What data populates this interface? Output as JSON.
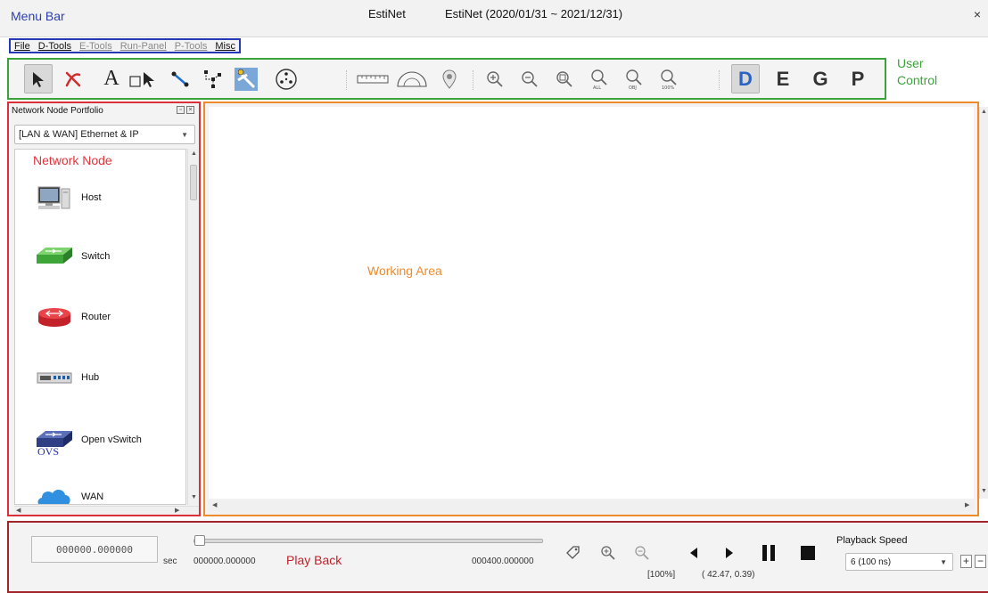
{
  "window": {
    "annotation_menubar": "Menu Bar",
    "app_name": "EstiNet",
    "title": "EstiNet  (2020/01/31 ~ 2021/12/31)",
    "close": "×"
  },
  "menubar": {
    "items": [
      {
        "label": "File",
        "enabled": true
      },
      {
        "label": "D-Tools",
        "enabled": true
      },
      {
        "label": "E-Tools",
        "enabled": false
      },
      {
        "label": "Run-Panel",
        "enabled": false
      },
      {
        "label": "P-Tools",
        "enabled": false
      },
      {
        "label": "Misc",
        "enabled": true
      }
    ]
  },
  "toolbar": {
    "annotation_line1": "User",
    "annotation_line2": "Control",
    "mode_letters": [
      "D",
      "E",
      "G",
      "P"
    ],
    "active_mode": "D",
    "text_tool_glyph": "A"
  },
  "portfolio": {
    "title": "Network Node Portfolio",
    "category": "[LAN & WAN] Ethernet & IP",
    "annotation": "Network Node",
    "nodes": [
      {
        "label": "Host",
        "icon": "host-icon"
      },
      {
        "label": "Switch",
        "icon": "switch-icon"
      },
      {
        "label": "Router",
        "icon": "router-icon"
      },
      {
        "label": "Hub",
        "icon": "hub-icon"
      },
      {
        "label": "Open vSwitch",
        "icon": "ovs-icon",
        "badge": "OVS"
      },
      {
        "label": "WAN",
        "icon": "cloud-icon"
      }
    ]
  },
  "workarea": {
    "annotation": "Working Area"
  },
  "playback": {
    "current_time": "000000.000000",
    "unit": "sec",
    "start_time": "000000.000000",
    "annotation": "Play Back",
    "end_time": "000400.000000",
    "speed_label": "Playback Speed",
    "speed_value": "6 (100 ns)",
    "plus": "+",
    "minus": "−"
  },
  "status": {
    "zoom": "[100%]",
    "coords": "( 42.47, 0.39)"
  },
  "colors": {
    "menubar_frame": "#2438b8",
    "toolbar_frame": "#3aa33a",
    "portfolio_frame": "#d9303a",
    "workarea_frame": "#ef8a2a",
    "playback_frame": "#a3242b"
  }
}
